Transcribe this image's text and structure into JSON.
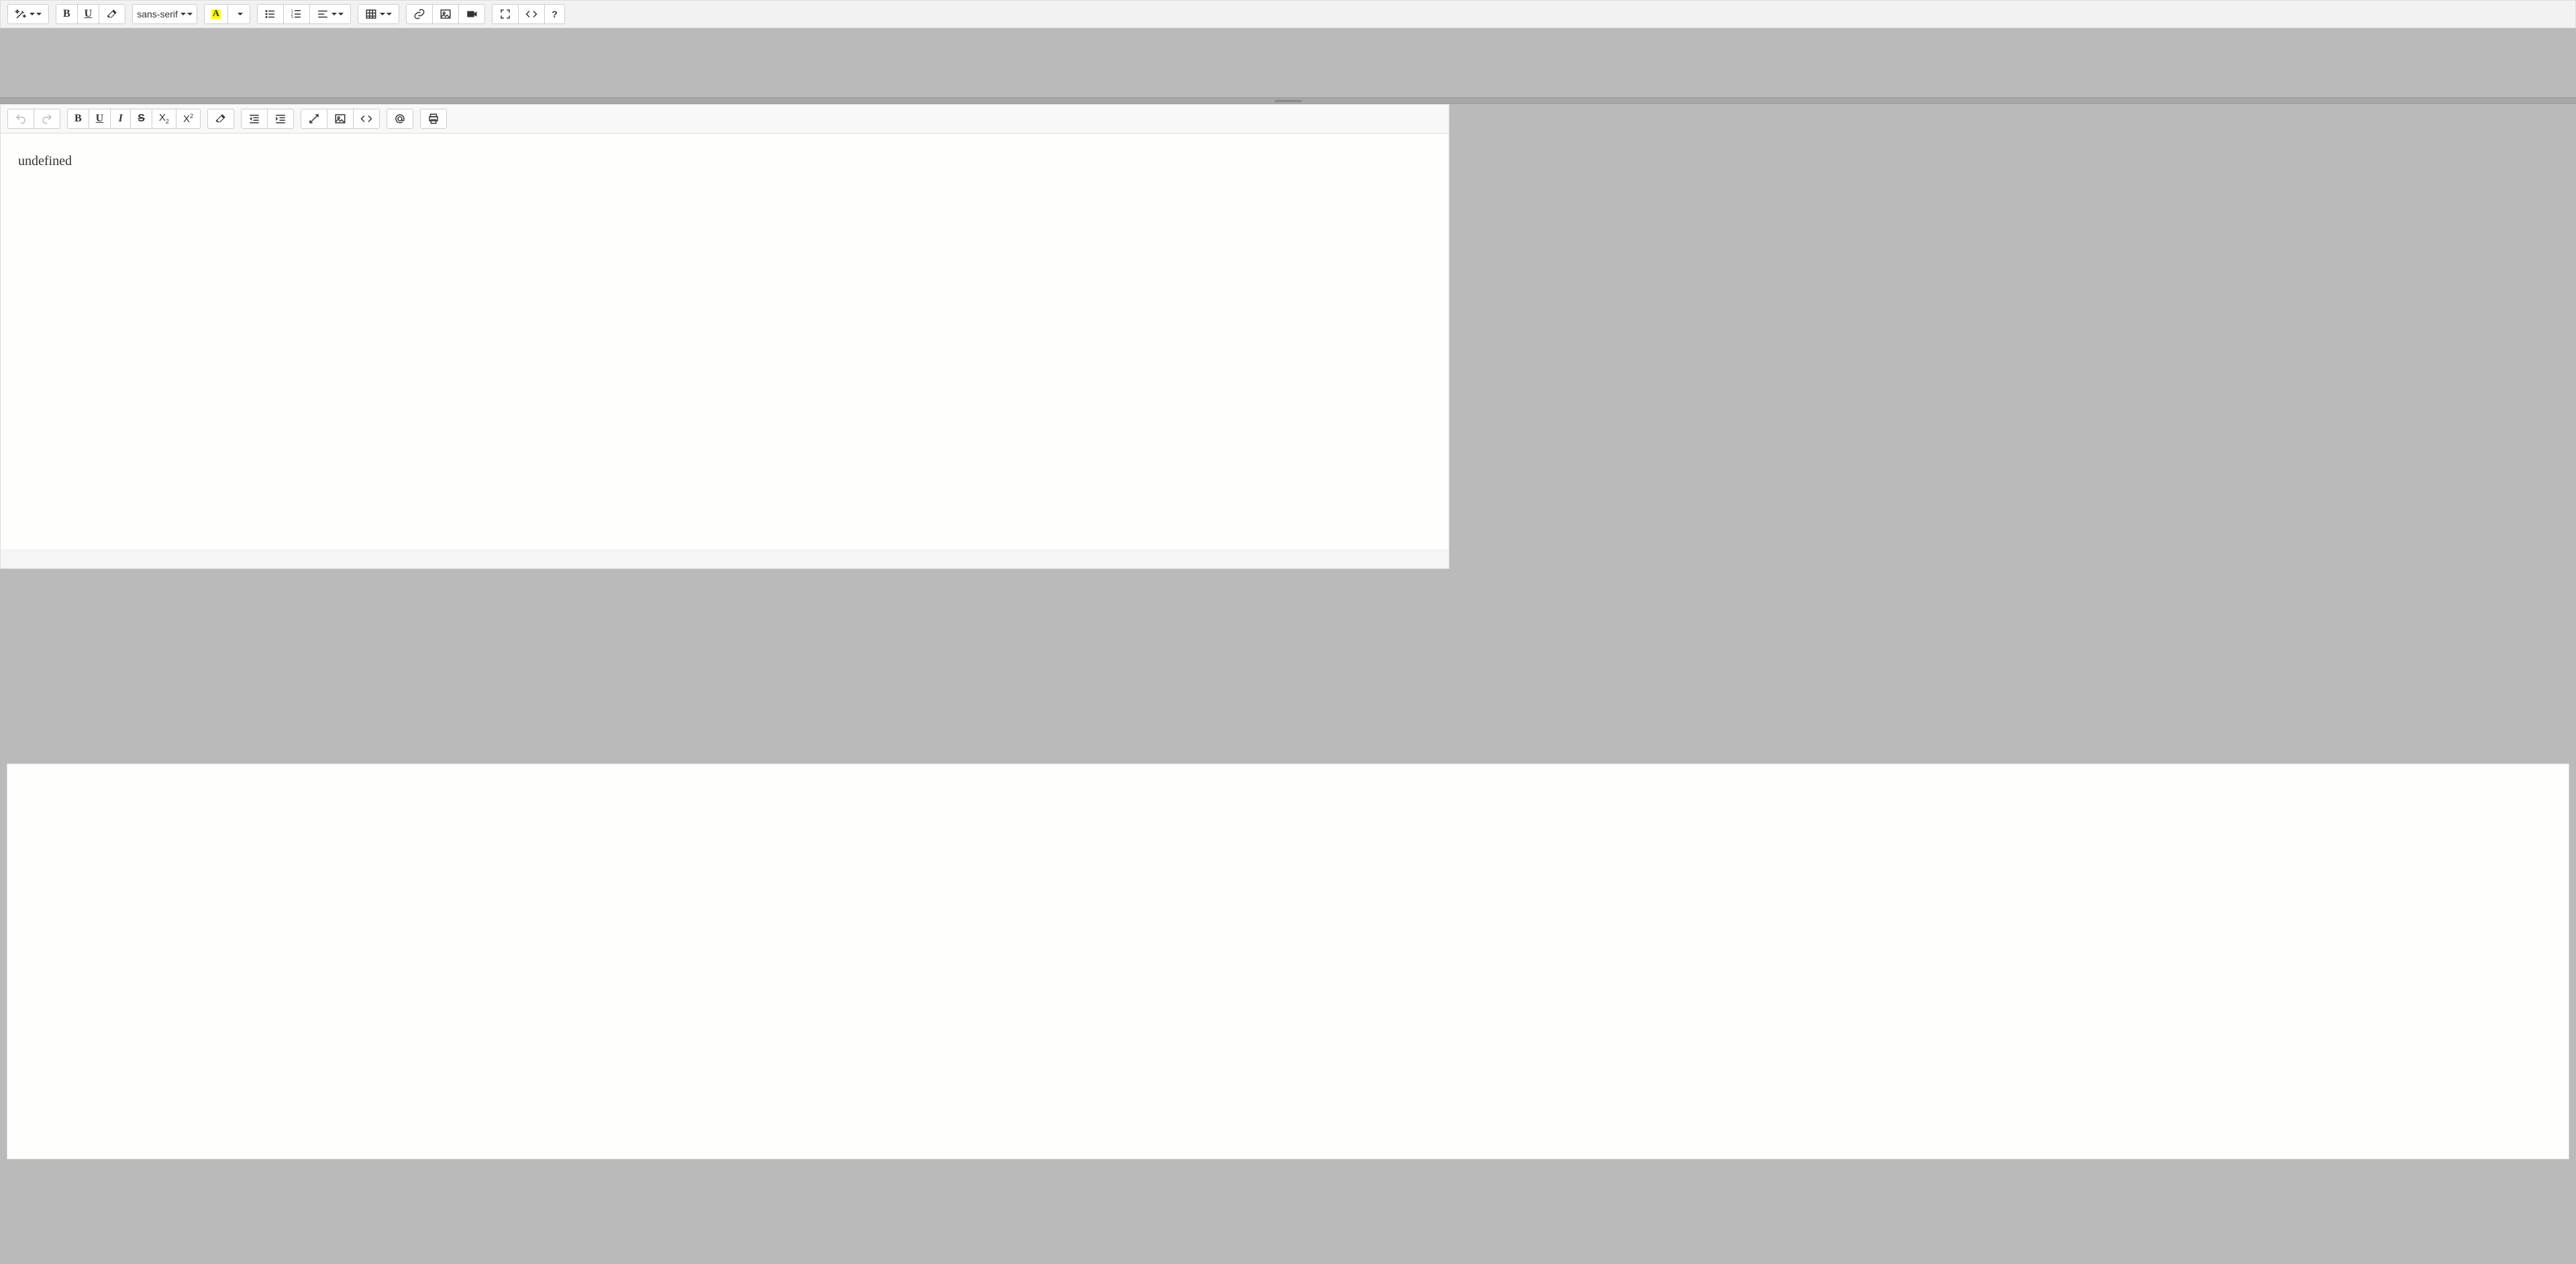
{
  "top_toolbar": {
    "font_family_label": "sans-serif"
  },
  "second_editor": {
    "content_text": "undefined"
  }
}
